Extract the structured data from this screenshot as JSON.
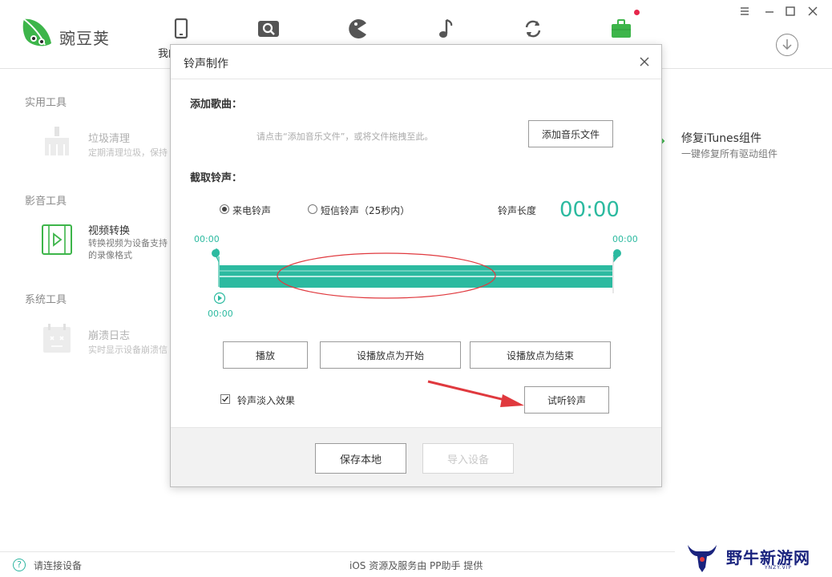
{
  "app": {
    "logo_text": "豌豆荚",
    "nav": [
      {
        "icon": "phone-icon",
        "label": "我的手机"
      },
      {
        "icon": "search-icon"
      },
      {
        "icon": "pacman-icon"
      },
      {
        "icon": "music-icon"
      },
      {
        "icon": "sync-icon"
      },
      {
        "icon": "toolbox-icon",
        "badge": true
      }
    ]
  },
  "sections": {
    "practical": {
      "title": "实用工具",
      "tool": {
        "icon": "broom-icon",
        "name": "垃圾清理",
        "desc": "定期清理垃圾，保持"
      }
    },
    "media": {
      "title": "影音工具",
      "tool": {
        "icon": "video-convert-icon",
        "name": "视频转换",
        "desc": "转换视频为设备支持的录像格式"
      }
    },
    "system": {
      "title": "系统工具",
      "tool": {
        "icon": "crash-log-icon",
        "name": "崩溃日志",
        "desc": "实时显示设备崩溃信"
      }
    }
  },
  "right_tool": {
    "name": "修复iTunes组件",
    "desc": "一键修复所有驱动组件"
  },
  "dialog": {
    "title": "铃声制作",
    "add_song_label": "添加歌曲：",
    "hint": "请点击“添加音乐文件”，或将文件拖拽至此。",
    "add_music_button": "添加音乐文件",
    "cut_label": "截取铃声：",
    "radio_call": "来电铃声",
    "radio_sms": "短信铃声（25秒内）",
    "length_label": "铃声长度",
    "length_value": "00:00",
    "start_time": "00:00",
    "end_time": "00:00",
    "play_time": "00:00",
    "play_button": "播放",
    "set_start_button": "设播放点为开始",
    "set_end_button": "设播放点为结束",
    "fade_label": "铃声淡入效果",
    "preview_button": "试听铃声",
    "save_button": "保存本地",
    "import_button": "导入设备"
  },
  "footer": {
    "status": "请连接设备",
    "center": "iOS 资源及服务由 PP助手 提供"
  },
  "watermark": {
    "text": "野牛新游网",
    "sub": "YNZY.VIP"
  },
  "colors": {
    "accent": "#2cbaa0",
    "annotation_red": "#e0393e"
  }
}
